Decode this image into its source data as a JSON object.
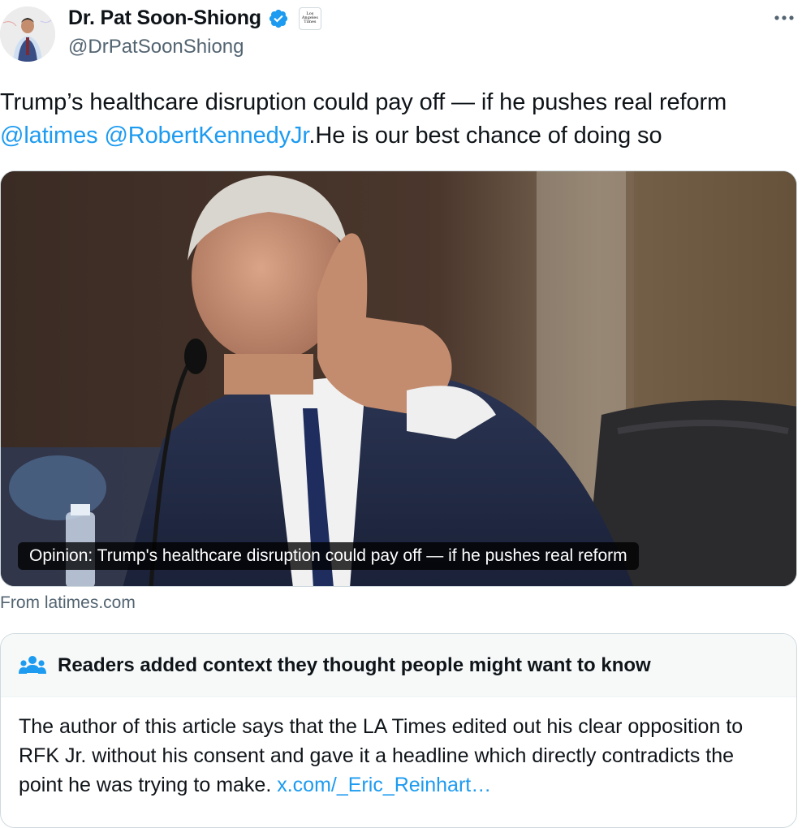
{
  "author": {
    "name": "Dr. Pat Soon-Shiong",
    "handle": "@DrPatSoonShiong",
    "affiliation_badge": "Los Angeles Times"
  },
  "icons": {
    "verified": "verified-badge-icon",
    "more": "more-options-icon",
    "note": "people-icon"
  },
  "colors": {
    "link": "#1d9bf0",
    "verified": "#1d9bf0",
    "muted": "#536471"
  },
  "tweet": {
    "text_1": "Trump’s healthcare disruption could pay off — if he pushes real reform",
    "mention_1": "@latimes",
    "space": " ",
    "mention_2": "@RobertKennedyJr",
    "text_2": ".He is our best chance of doing so"
  },
  "card": {
    "caption": "Opinion: Trump's healthcare disruption could pay off — if he pushes real reform",
    "source": "From latimes.com"
  },
  "community_note": {
    "title": "Readers added context they thought people might want to know",
    "body": "The author of this article says that the LA Times edited out his clear opposition to RFK Jr. without his consent and gave it a headline which directly contradicts the point he was trying to make.",
    "link": "x.com/_Eric_Reinhart…"
  }
}
